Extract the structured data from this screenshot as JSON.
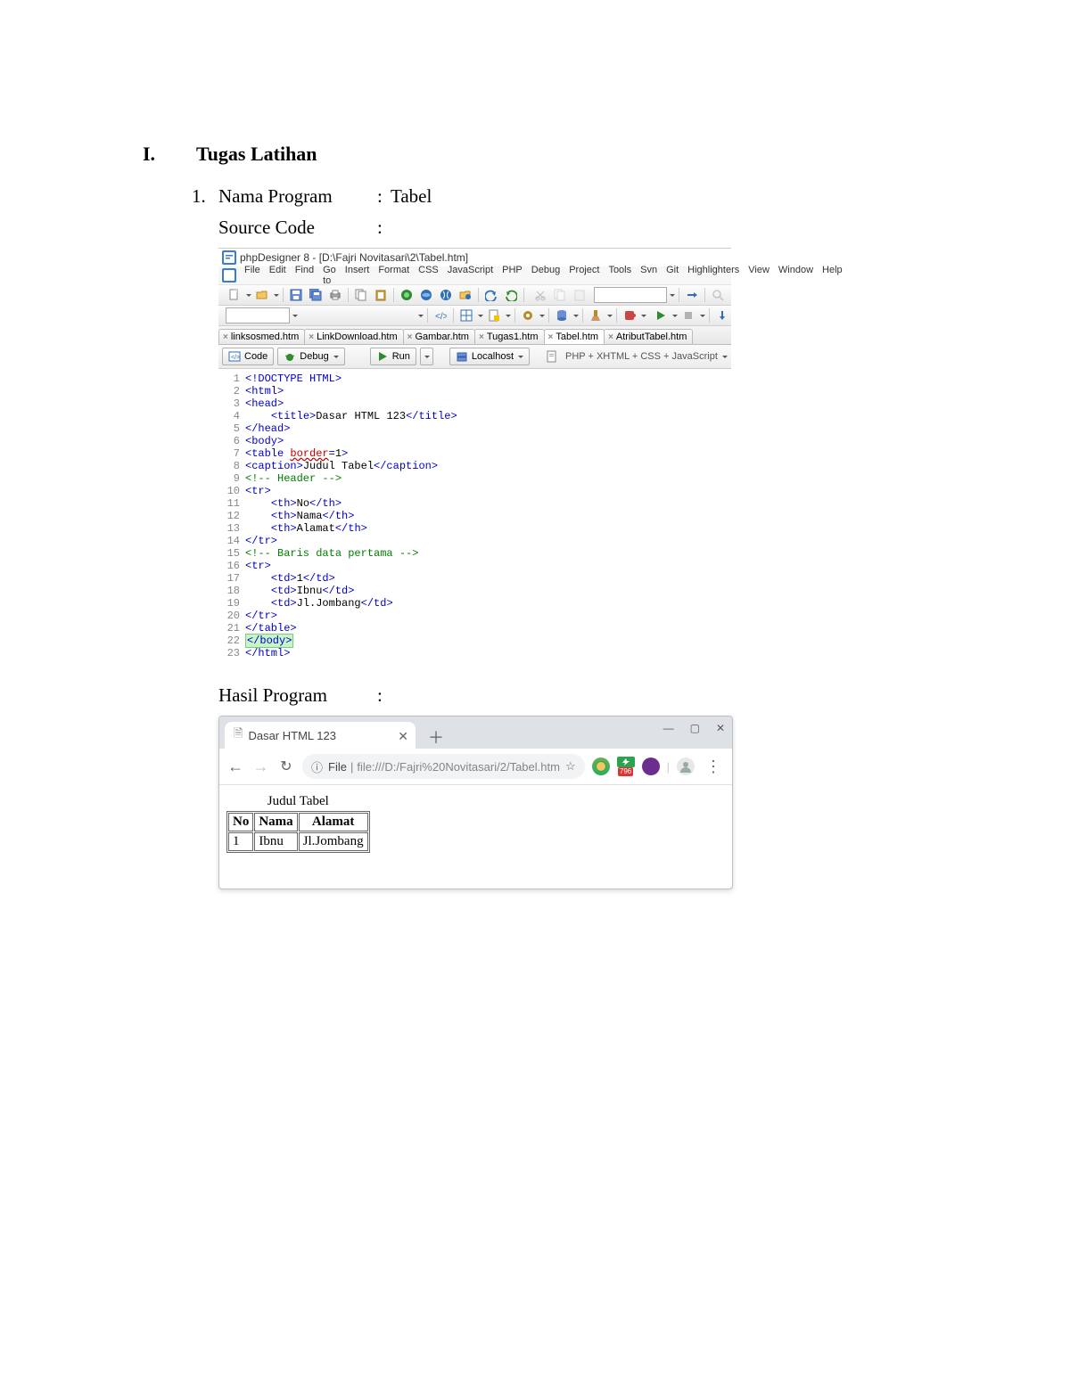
{
  "doc": {
    "section_number": "I.",
    "section_title": "Tugas Latihan",
    "item1_number": "1.",
    "item1_label": "Nama Program",
    "item1_value": "Tabel",
    "source_code_label": "Source Code",
    "result_label": "Hasil Program",
    "colon": ":"
  },
  "ide": {
    "title": "phpDesigner 8 - [D:\\Fajri Novitasari\\2\\Tabel.htm]",
    "menu": [
      "File",
      "Edit",
      "Find",
      "Go to",
      "Insert",
      "Format",
      "CSS",
      "JavaScript",
      "PHP",
      "Debug",
      "Project",
      "Tools",
      "Svn",
      "Git",
      "Highlighters",
      "View",
      "Window",
      "Help"
    ],
    "file_tabs": [
      "linksosmed.htm",
      "LinkDownload.htm",
      "Gambar.htm",
      "Tugas1.htm",
      "Tabel.htm",
      "AtributTabel.htm"
    ],
    "active_file_tab": 4,
    "actions": {
      "code": "Code",
      "debug": "Debug",
      "run": "Run",
      "localhost": "Localhost",
      "mode": "PHP + XHTML + CSS + JavaScript"
    },
    "code_lines": [
      {
        "n": "1",
        "html": "<span class='kw'>&lt;!DOCTYPE HTML&gt;</span>"
      },
      {
        "n": "2",
        "html": "<span class='kw'>&lt;html&gt;</span>"
      },
      {
        "n": "3",
        "html": "<span class='kw'>&lt;head&gt;</span>"
      },
      {
        "n": "4",
        "html": "    <span class='kw'>&lt;title&gt;</span>Dasar HTML 123<span class='kw'>&lt;/title&gt;</span>"
      },
      {
        "n": "5",
        "html": "<span class='kw'>&lt;/head&gt;</span>"
      },
      {
        "n": "6",
        "html": "<span class='kw'>&lt;body&gt;</span>"
      },
      {
        "n": "7",
        "html": "<span class='kw'>&lt;table </span><span class='err'>border</span><span class='kw'>=</span>1<span class='kw'>&gt;</span>"
      },
      {
        "n": "8",
        "html": "<span class='kw'>&lt;caption&gt;</span>Judul Tabel<span class='kw'>&lt;/caption&gt;</span>"
      },
      {
        "n": "9",
        "html": "<span class='com'>&lt;!-- Header --&gt;</span>"
      },
      {
        "n": "10",
        "html": "<span class='kw'>&lt;tr&gt;</span>"
      },
      {
        "n": "11",
        "html": "    <span class='kw'>&lt;th&gt;</span>No<span class='kw'>&lt;/th&gt;</span>"
      },
      {
        "n": "12",
        "html": "    <span class='kw'>&lt;th&gt;</span>Nama<span class='kw'>&lt;/th&gt;</span>"
      },
      {
        "n": "13",
        "html": "    <span class='kw'>&lt;th&gt;</span>Alamat<span class='kw'>&lt;/th&gt;</span>"
      },
      {
        "n": "14",
        "html": "<span class='kw'>&lt;/tr&gt;</span>"
      },
      {
        "n": "15",
        "html": "<span class='com'>&lt;!-- Baris data pertama --&gt;</span>"
      },
      {
        "n": "16",
        "html": "<span class='kw'>&lt;tr&gt;</span>"
      },
      {
        "n": "17",
        "html": "    <span class='kw'>&lt;td&gt;</span>1<span class='kw'>&lt;/td&gt;</span>"
      },
      {
        "n": "18",
        "html": "    <span class='kw'>&lt;td&gt;</span>Ibnu<span class='kw'>&lt;/td&gt;</span>"
      },
      {
        "n": "19",
        "html": "    <span class='kw'>&lt;td&gt;</span>Jl.Jombang<span class='kw'>&lt;/td&gt;</span>"
      },
      {
        "n": "20",
        "html": "<span class='kw'>&lt;/tr&gt;</span>"
      },
      {
        "n": "21",
        "html": "<span class='kw'>&lt;/table&gt;</span>"
      },
      {
        "n": "22",
        "html": "<span class='hl'><span class='kw'>&lt;/body&gt;</span></span>"
      },
      {
        "n": "23",
        "html": "<span class='kw'>&lt;/html&gt;</span>"
      }
    ]
  },
  "browser": {
    "tab_title": "Dasar HTML 123",
    "url_scheme": "File",
    "url": "file:///D:/Fajri%20Novitasari/2/Tabel.htm",
    "page": {
      "caption": "Judul Tabel",
      "headers": [
        "No",
        "Nama",
        "Alamat"
      ],
      "row": [
        "1",
        "Ibnu",
        "Jl.Jombang"
      ]
    },
    "ext_badge": "796"
  },
  "icons": {
    "min": "—",
    "max": "▢",
    "close": "✕",
    "plus": "＋",
    "back": "←",
    "forward": "→",
    "reload": "↻",
    "info": "ⓘ",
    "star": "☆",
    "menu": "⋮",
    "doc": "🗎"
  }
}
